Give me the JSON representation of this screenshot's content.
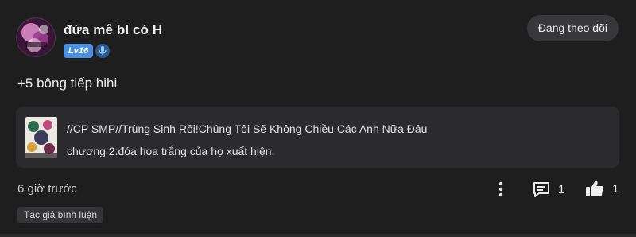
{
  "comment": {
    "username": "đứa mê bl có H",
    "level": "Lv16",
    "follow_label": "Đang theo dõi",
    "text": "+5 bông tiếp hihi",
    "timestamp": "6 giờ trước",
    "reply_count": "1",
    "like_count": "1",
    "author_tag": "Tác giả bình luận"
  },
  "reference": {
    "title": "//CP SMP//Trùng Sinh Rồi!Chúng Tôi Sẽ Không Chiều Các Anh Nữa Đâu",
    "chapter": "chương 2:đóa hoa trắng của họ xuất hiện."
  },
  "icons": {
    "avatar": "avatar-image",
    "mic": "microphone-icon",
    "more": "more-vertical-icon",
    "reply": "comment-icon",
    "like": "thumbs-up-icon"
  },
  "colors": {
    "background": "#1e1e1f",
    "level_badge": "#4a8fe0",
    "reference_card": "#2b2b2d",
    "follow_button": "#38383a"
  }
}
